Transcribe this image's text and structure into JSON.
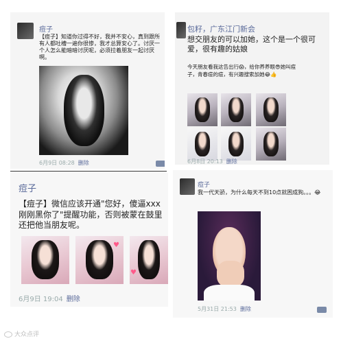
{
  "post1": {
    "username": "痘子",
    "text": "【痘子】知道你过得不好，我并不安心，真到跟所有人都吐槽一遍你很惨，我才总算安心了。讨厌一个人怎么能暗暗讨厌呢，必须拉着朋友一起讨厌啊。",
    "time": "6月9日 08:28",
    "delete_label": "删除"
  },
  "post2": {
    "username": "包籽，广东江门新会",
    "text": "想交朋友的可以加她，这个是一个很可爱，很有趣的姑娘",
    "subtext": "今天朋友看我这告出行😱，给你养养眼😎她叫痘子，青春痘的痘，有兴趣搜索加她😂👍",
    "time": "6月8日 20:13",
    "delete_label": "删除"
  },
  "post3": {
    "username": "痘子",
    "text": "【痘子】微信应该开通\"您好，傻逼xxx刚刚黑你了\"提醒功能，否则被蒙在鼓里还把他当朋友呢。",
    "time": "6月9日 19:04",
    "delete_label": "删除"
  },
  "post4": {
    "username": "痘子",
    "text": "我一代天骄，为什么每天不到10点就困成狗。。。😂",
    "time": "5月31日 21:53",
    "delete_label": "删除"
  },
  "watermark": "大众点评"
}
